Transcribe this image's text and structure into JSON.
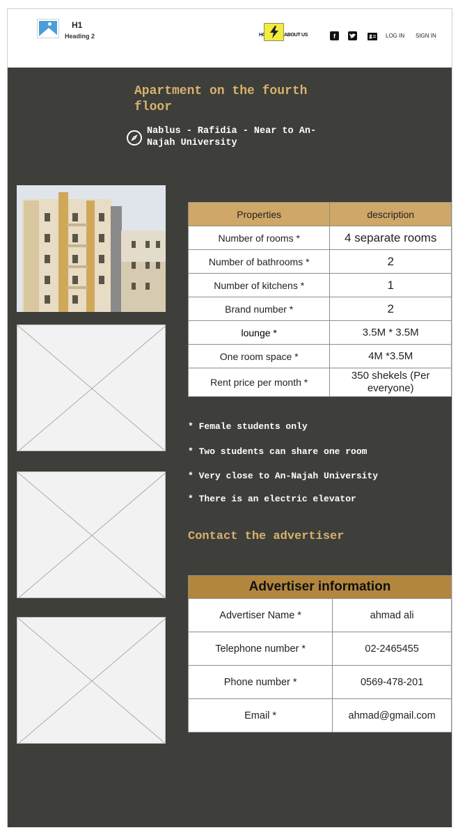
{
  "header": {
    "h1": "H1",
    "h2": "Heading 2",
    "nav_home": "HOME",
    "nav_about": "ABOUT US",
    "login": "LOG IN",
    "signin": "SIGN IN",
    "icons": [
      "image-icon",
      "bolt-icon",
      "facebook-icon",
      "twitter-icon",
      "contact-card-icon"
    ]
  },
  "listing": {
    "title": "Apartment on the fourth floor",
    "location": "Nablus - Rafidia - Near to An-Najah University"
  },
  "properties": {
    "headers": [
      "Properties",
      "description"
    ],
    "rows": [
      {
        "label": "Number of rooms *",
        "value": "4 separate rooms"
      },
      {
        "label": "Number of bathrooms *",
        "value": "2"
      },
      {
        "label": "Number of kitchens *",
        "value": "1"
      },
      {
        "label": "Brand number *",
        "value": "2"
      },
      {
        "label": "lounge *",
        "value": "3.5M * 3.5M"
      },
      {
        "label": "One room space *",
        "value": "4M *3.5M"
      },
      {
        "label": "Rent price per month *",
        "value": "350 shekels (Per everyone)"
      }
    ]
  },
  "notes": [
    "* Female students only",
    "* Two students can share one room",
    "* Very close to An-Najah University",
    "* There is an electric elevator"
  ],
  "contact_heading": "Contact the advertiser",
  "advertiser": {
    "title": "Advertiser information",
    "rows": [
      {
        "label": "Advertiser Name *",
        "value": "ahmad ali"
      },
      {
        "label": "Telephone number *",
        "value": "02-2465455"
      },
      {
        "label": "Phone number *",
        "value": "0569-478-201"
      },
      {
        "label": "Email *",
        "value": "ahmad@gmail.com"
      }
    ]
  },
  "colors": {
    "panel_bg": "#3e3e3a",
    "accent_text": "#d8b26e",
    "table_header": "#cfa767",
    "advertiser_header": "#b3863e"
  }
}
